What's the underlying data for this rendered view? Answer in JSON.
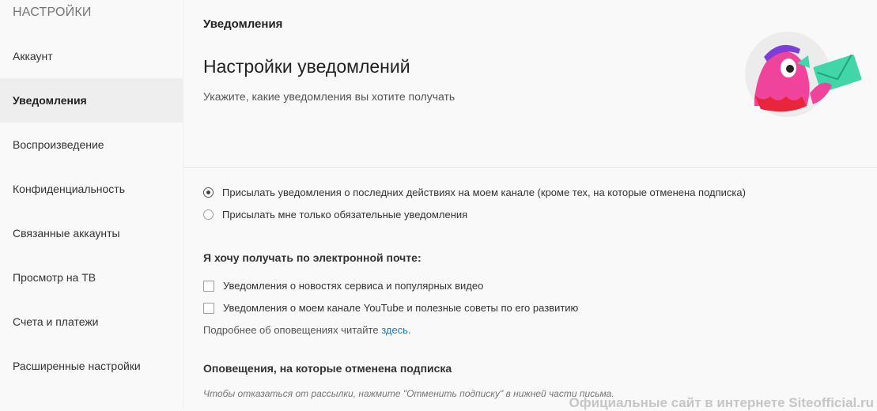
{
  "sidebar": {
    "header": "НАСТРОЙКИ",
    "items": [
      {
        "label": "Аккаунт"
      },
      {
        "label": "Уведомления"
      },
      {
        "label": "Воспроизведение"
      },
      {
        "label": "Конфиденциальность"
      },
      {
        "label": "Связанные аккаунты"
      },
      {
        "label": "Просмотр на ТВ"
      },
      {
        "label": "Счета и платежи"
      },
      {
        "label": "Расширенные настройки"
      }
    ],
    "active_index": 1
  },
  "main": {
    "section_label": "Уведомления",
    "title": "Настройки уведомлений",
    "subtitle": "Укажите, какие уведомления вы хотите получать",
    "radio_options": [
      {
        "label": "Присылать уведомления о последних действиях на моем канале (кроме тех, на которые отменена подписка)",
        "checked": true
      },
      {
        "label": "Присылать мне только обязательные уведомления",
        "checked": false
      }
    ],
    "email_heading": "Я хочу получать по электронной почте:",
    "email_options": [
      {
        "label": "Уведомления о новостях сервиса и популярных видео",
        "checked": false
      },
      {
        "label": "Уведомления о моем канале YouTube и полезные советы по его развитию",
        "checked": false
      }
    ],
    "more_info_text": "Подробнее об оповещениях читайте",
    "more_info_link": "здесь",
    "more_info_suffix": ".",
    "unsub_heading": "Оповещения, на которые отменена подписка",
    "unsub_note": "Чтобы отказаться от рассылки, нажмите \"Отменить подписку\" в нижней части письма."
  },
  "watermark": "Официальные сайт в интернете Siteofficial.ru",
  "colors": {
    "link": "#167ac6",
    "active_bg": "#eeeeee",
    "illustration_pink": "#f0449c",
    "illustration_purple": "#7b3fd6",
    "illustration_teal": "#40d6a8",
    "illustration_red": "#e8253a"
  }
}
